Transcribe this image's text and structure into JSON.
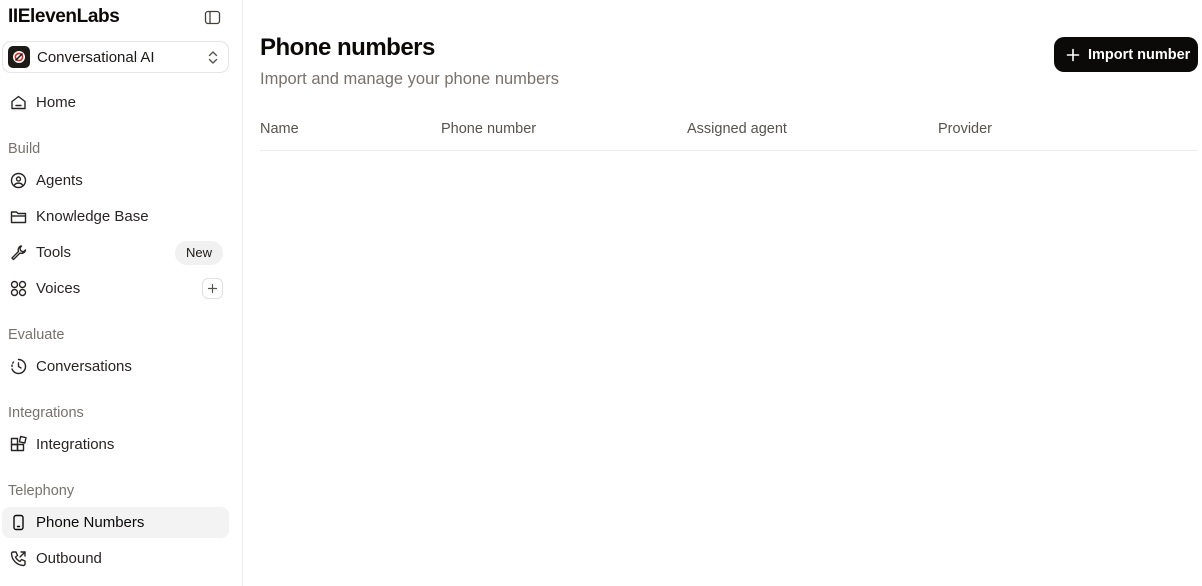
{
  "app": {
    "logo_text": "IIElevenLabs"
  },
  "workspace": {
    "label": "Conversational AI"
  },
  "sidebar": {
    "home": "Home",
    "sections": {
      "build": "Build",
      "evaluate": "Evaluate",
      "integrations": "Integrations",
      "telephony": "Telephony"
    },
    "items": {
      "agents": "Agents",
      "knowledge_base": "Knowledge Base",
      "tools": "Tools",
      "tools_badge": "New",
      "voices": "Voices",
      "conversations": "Conversations",
      "integrations": "Integrations",
      "phone_numbers": "Phone Numbers",
      "outbound": "Outbound"
    },
    "active_item": "phone_numbers"
  },
  "main": {
    "title": "Phone numbers",
    "subtitle": "Import and manage your phone numbers",
    "import_button": "Import number",
    "table": {
      "columns": [
        "Name",
        "Phone number",
        "Assigned agent",
        "Provider"
      ],
      "rows": []
    }
  },
  "colors": {
    "primary_button": "#0c0a09",
    "active_nav_bg": "#f3f3f3",
    "muted_text": "#78716c"
  }
}
